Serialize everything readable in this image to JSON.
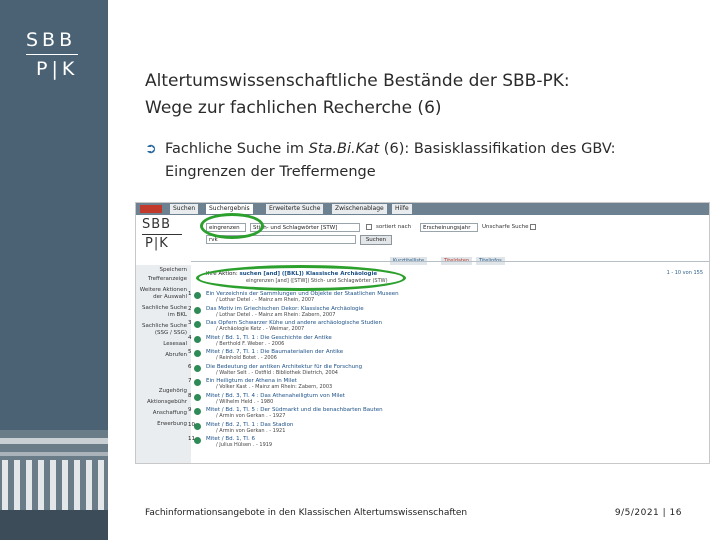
{
  "brand": {
    "logo_top": "SBB",
    "logo_bottom": "P|K"
  },
  "slide": {
    "title_line1": "Altertumswissenschaftliche Bestände der SBB-PK:",
    "title_line2": "Wege zur fachlichen Recherche (6)",
    "bullet_symbol": "Ü",
    "bullet_pre": "Fachliche Suche im ",
    "bullet_italic": "Sta.Bi.Kat",
    "bullet_post": " (6): Basisklassifikation des GBV:",
    "bullet_line2": "Eingrenzen der Treffermenge"
  },
  "screenshot": {
    "tabs": [
      "Suchen",
      "Suchergebnis",
      "Erweiterte Suche",
      "Zwischenablage",
      "Hilfe"
    ],
    "logo_top": "SBB",
    "logo_bottom": "P|K",
    "search_field1_value": "eingrenzen",
    "search_mode_value": "Stich- und Schlagwörter [STW]",
    "sort_label": "sortiert nach",
    "sort_value": "Erscheinungsjahr",
    "unscharf_label": "Unscharfe Suche",
    "search_field2_value": "rvk",
    "search_button": "Suchen",
    "result_tabs": [
      "Kurztitelliste",
      "Titeldaten",
      "Titelinfos"
    ],
    "result_head_prefix": "Ihre Aktion:",
    "result_head_action": "suchen [and] ([BKL]) Klassische Archäologie",
    "result_sub": "eingrenzen [and] ([STW]) Stich- und Schlagwörter (STW)",
    "pager": "1 - 10 von 155",
    "side_items": [
      "Speichern",
      "Trefferanzeige",
      "Weitere Aktionen",
      "der Auswahl",
      "Sachliche Suche",
      "im BKL",
      "Sachliche Suche",
      "(SSG / SSG)",
      "Lesesaal",
      "Abrufen",
      "Zugehörig",
      "Aktionsgebühr",
      "Anschaffung",
      "Erwerbung"
    ],
    "results": [
      {
        "no": "1",
        "title": "Ein Verzeichnis der Sammlungen und Objekte der Staatlichen Museen",
        "detail": "/ Lothar Detel . - Mainz am Rhein, 2007"
      },
      {
        "no": "2",
        "title": "Das Motiv im Griechischen Dekor: Klassische Archäologie",
        "detail": "/ Lothar Detel . - Mainz am Rhein: Zabern, 2007"
      },
      {
        "no": "3",
        "title": "Das Opfern Schwarzer Kühe und andere archäologische Studien",
        "detail": "/ Archäologie Ketz . - Weimar, 2007"
      },
      {
        "no": "4",
        "title": "Mitet / Bd. 1, Tl. 1 : Die Geschichte der Antike",
        "detail": "/ Berthold F. Weber . - 2006"
      },
      {
        "no": "5",
        "title": "Mitet / Bd. 7, Tl. 1 : Die Baumaterialien der Antike",
        "detail": "/ Reinhold Botet . - 2006"
      },
      {
        "no": "6",
        "title": "Die Bedeutung der antiken Architektur für die Forschung",
        "detail": "/ Walter Selt . - Ostfild : Bibliothek Dietrich, 2004"
      },
      {
        "no": "7",
        "title": "Ein Heiligtum der Athena in Milet",
        "detail": "/ Volker Kast . - Mainz am Rhein: Zabern, 2003"
      },
      {
        "no": "8",
        "title": "Mitet / Bd. 3, Tl. 4 : Das Athenaheiligtum von Milet",
        "detail": "/ Wilhelm Held . - 1980"
      },
      {
        "no": "9",
        "title": "Mitet / Bd. 1, Tl. 5 : Der Südmarkt und die benachbarten Bauten",
        "detail": "/ Armin von Gerkan . - 1927"
      },
      {
        "no": "10",
        "title": "Mitet / Bd. 2, Tl. 1 : Das Stadion",
        "detail": "/ Armin von Gerkan . - 1921"
      },
      {
        "no": "11",
        "title": "Mitet / Bd. 1, Tl. 6",
        "detail": "/ Julius Hülsen . - 1919"
      }
    ]
  },
  "footer": {
    "left": "Fachinformationsangebote in den Klassischen Altertumswissenschaften",
    "right": "9/5/2021 | 16"
  },
  "colors": {
    "brand": "#4a6274",
    "highlight_ring": "#2ca02c",
    "link": "#1a4f86"
  }
}
